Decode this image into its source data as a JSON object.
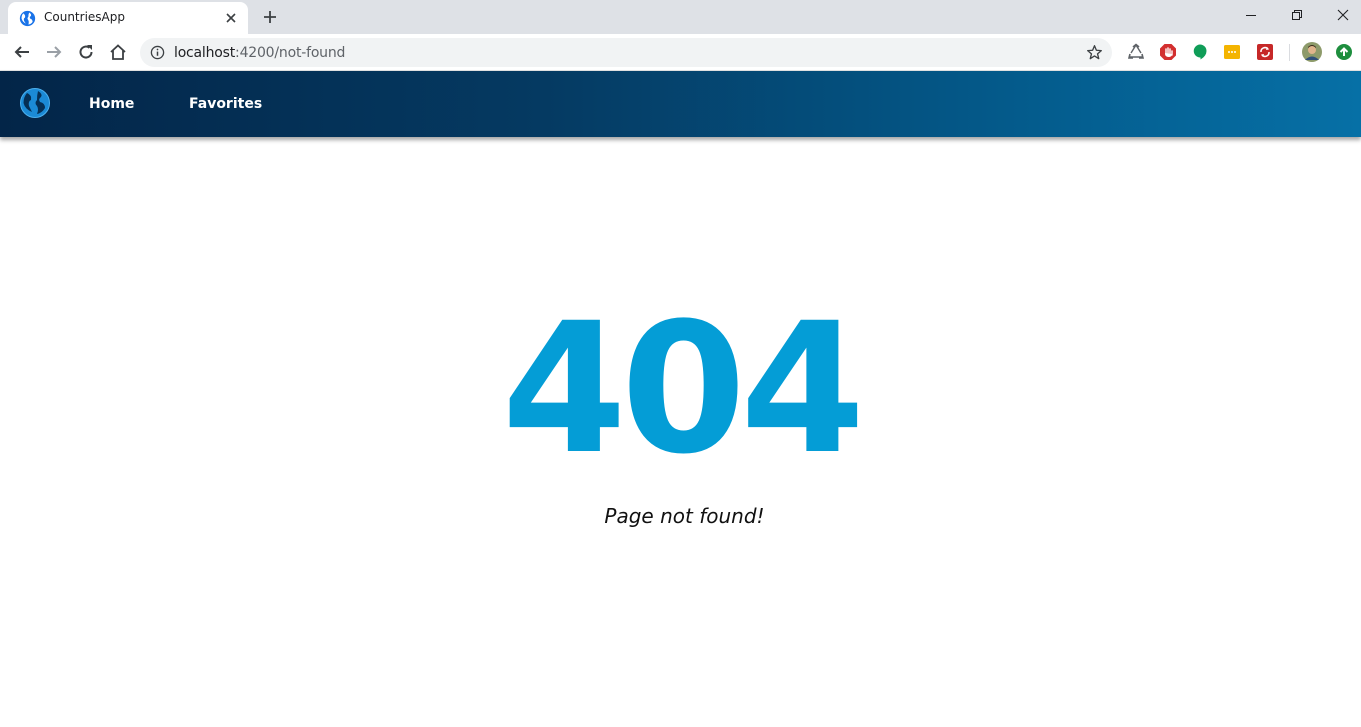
{
  "browser": {
    "tab_title": "CountriesApp",
    "url_host": "localhost",
    "url_path": ":4200/not-found"
  },
  "navbar": {
    "logo_icon": "globe-icon",
    "links": [
      {
        "label": "Home"
      },
      {
        "label": "Favorites"
      }
    ]
  },
  "error": {
    "code": "404",
    "message": "Page not found!"
  },
  "colors": {
    "accent": "#049dd6",
    "navbar_start": "#032548",
    "navbar_end": "#0670a6"
  }
}
